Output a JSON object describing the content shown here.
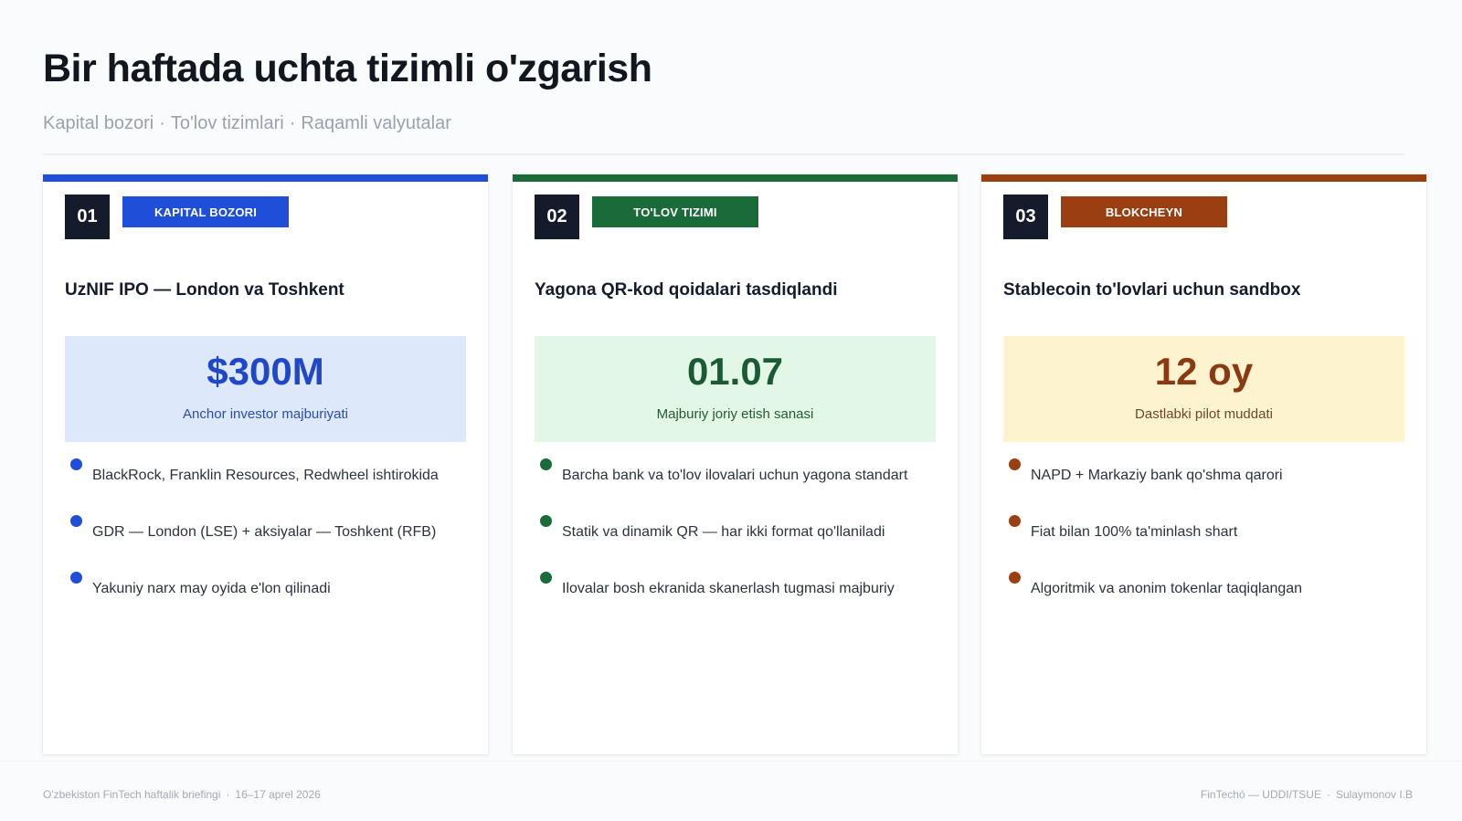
{
  "header": {
    "title": "Bir haftada uchta tizimli o'zgarish",
    "subtitle_parts": [
      "Kapital bozori",
      "To'lov tizimlari",
      "Raqamli valyutalar"
    ],
    "subtitle_separator": "·"
  },
  "cards": [
    {
      "number": "01",
      "tag": "KAPITAL BOZORI",
      "title": "UzNIF IPO — London va Toshkent",
      "highlight_value": "$300M",
      "highlight_caption": "Anchor investor majburiyati",
      "bullets": [
        "BlackRock, Franklin Resources, Redwheel ishtirokida",
        "GDR — London (LSE) + aksiyalar — Toshkent (RFB)",
        "Yakuniy narx may oyida e'lon qilinadi"
      ],
      "colors": {
        "accent": "#1f4fd8",
        "highlight_bg": "#dde9fb",
        "highlight_value": "#1f47c8",
        "highlight_caption": "#2a4ea8"
      }
    },
    {
      "number": "02",
      "tag": "TO'LOV TIZIMI",
      "title": "Yagona QR-kod qoidalari tasdiqlandi",
      "highlight_value": "01.07",
      "highlight_caption": "Majburiy joriy etish sanasi",
      "bullets": [
        "Barcha bank va to'lov ilovalari uchun yagona standart",
        "Statik va dinamik QR — har ikki format qo'llaniladi",
        "Ilovalar bosh ekranida skanerlash tugmasi majburiy"
      ],
      "colors": {
        "accent": "#1b6a3a",
        "highlight_bg": "#e2f7e6",
        "highlight_value": "#1b5a34",
        "highlight_caption": "#245a38"
      }
    },
    {
      "number": "03",
      "tag": "BLOKCHEYN",
      "title": "Stablecoin to'lovlari uchun sandbox",
      "highlight_value": "12 oy",
      "highlight_caption": "Dastlabki pilot muddati",
      "bullets": [
        "NAPD + Markaziy bank qo'shma qarori",
        "Fiat bilan 100% ta'minlash shart",
        "Algoritmik va anonim tokenlar taqiqlangan"
      ],
      "colors": {
        "accent": "#9a3f12",
        "highlight_bg": "#fdf3cf",
        "highlight_value": "#8a3a12",
        "highlight_caption": "#6a4a2a"
      }
    }
  ],
  "footer": {
    "left_parts": [
      "O'zbekiston FinTech haftalik briefingi",
      "16–17 aprel 2026"
    ],
    "right_parts": [
      "FinTechó — UDDI/TSUE",
      "Sulaymonov I.B"
    ],
    "separator": "·"
  }
}
